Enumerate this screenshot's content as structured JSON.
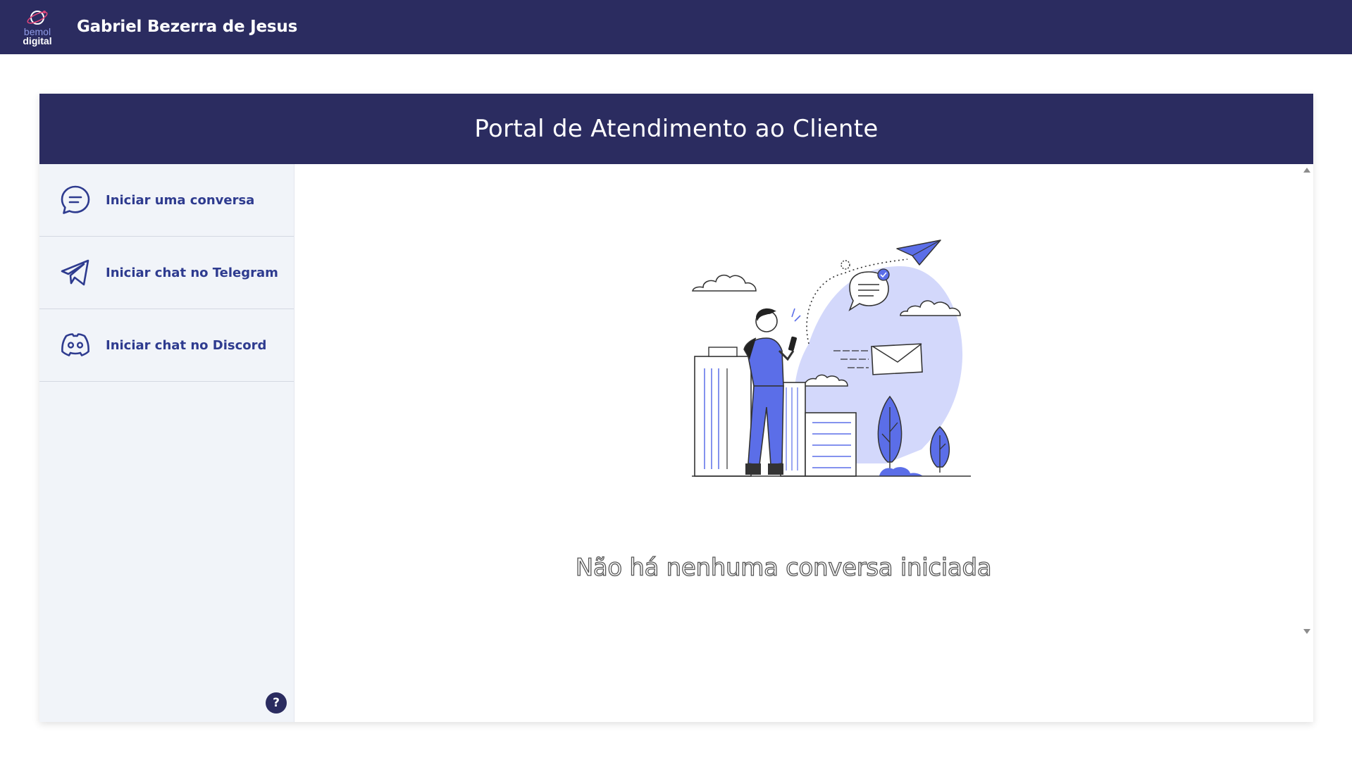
{
  "header": {
    "logo_line1": "bemol",
    "logo_line2": "digital",
    "user_name": "Gabriel Bezerra de Jesus"
  },
  "portal": {
    "title": "Portal de Atendimento ao Cliente"
  },
  "sidebar": {
    "items": [
      {
        "label": "Iniciar uma conversa",
        "icon": "chat-bubble-icon"
      },
      {
        "label": "Iniciar chat no Telegram",
        "icon": "telegram-icon"
      },
      {
        "label": "Iniciar chat no Discord",
        "icon": "discord-icon"
      }
    ],
    "help_label": "?"
  },
  "main": {
    "empty_message": "Não há nenhuma conversa iniciada"
  },
  "colors": {
    "navy": "#2b2c60",
    "accent": "#2e3b8f",
    "sidebar_bg": "#f1f4f9",
    "illustration": "#5b6ee8"
  }
}
